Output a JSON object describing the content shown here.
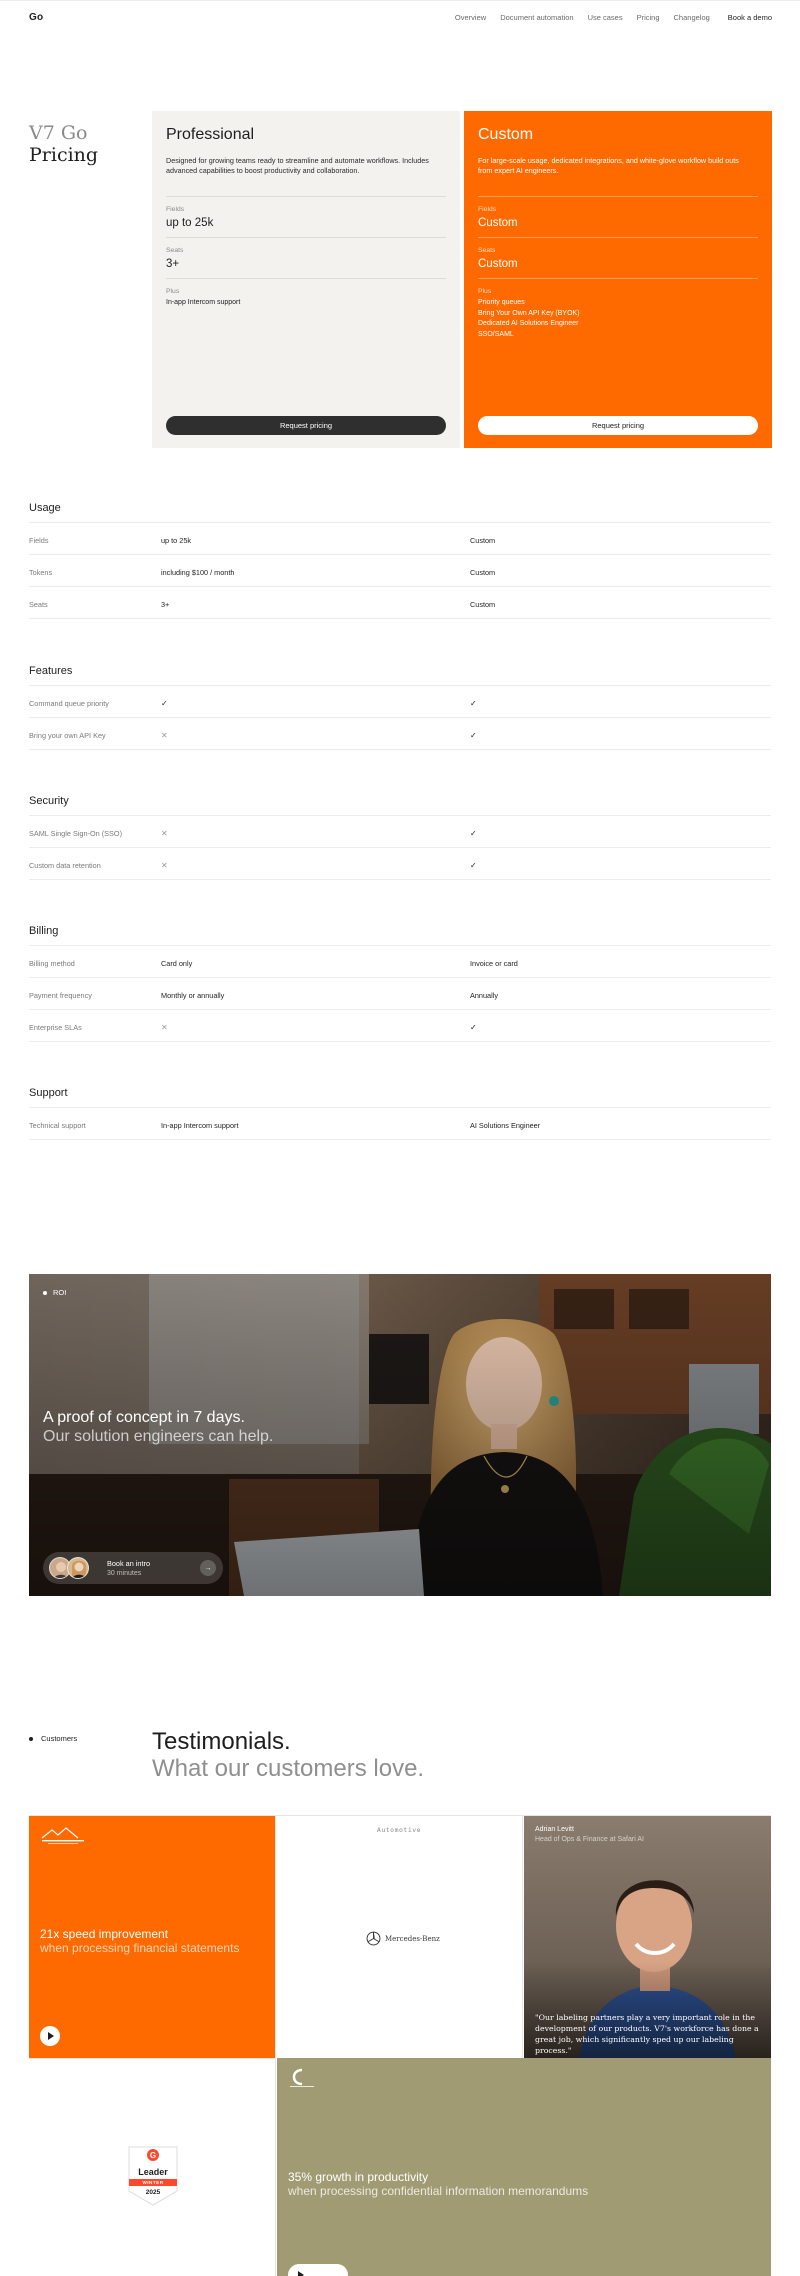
{
  "header": {
    "brand": "Go",
    "nav": [
      "Overview",
      "Document automation",
      "Use cases",
      "Pricing",
      "Changelog"
    ],
    "demo": "Book a demo"
  },
  "product": {
    "line1": "V7 Go",
    "line2": "Pricing"
  },
  "plans": {
    "pro": {
      "name": "Professional",
      "desc": "Designed for growing teams ready to streamline and automate workflows. Includes advanced capabilities to boost productivity and collaboration.",
      "fields_label": "Fields",
      "fields_value": "up to 25k",
      "seats_label": "Seats",
      "seats_value": "3+",
      "plus_label": "Plus",
      "plus": [
        "In-app Intercom support"
      ],
      "button": "Request pricing"
    },
    "custom": {
      "name": "Custom",
      "desc": "For large-scale usage, dedicated integrations, and white-glove workflow build outs from expert AI engineers.",
      "fields_label": "Fields",
      "fields_value": "Custom",
      "seats_label": "Seats",
      "seats_value": "Custom",
      "plus_label": "Plus",
      "plus": [
        "Priority queues",
        "Bring Your Own API Key (BYOK)",
        "Dedicated AI Solutions Engineer",
        "SSO/SAML"
      ],
      "button": "Request pricing"
    }
  },
  "sections": {
    "usage": {
      "title": "Usage",
      "rows": [
        {
          "k": "Fields",
          "p": "up to 25k",
          "c": "Custom"
        },
        {
          "k": "Tokens",
          "p": "including $100 / month",
          "c": "Custom"
        },
        {
          "k": "Seats",
          "p": "3+",
          "c": "Custom"
        }
      ]
    },
    "features": {
      "title": "Features",
      "rows": [
        {
          "k": "Command queue priority",
          "p": "✓",
          "c": "✓"
        },
        {
          "k": "Bring your own API Key",
          "p": "✕",
          "c": "✓"
        }
      ]
    },
    "security": {
      "title": "Security",
      "rows": [
        {
          "k": "SAML Single Sign-On (SSO)",
          "p": "✕",
          "c": "✓"
        },
        {
          "k": "Custom data retention",
          "p": "✕",
          "c": "✓"
        }
      ]
    },
    "billing": {
      "title": "Billing",
      "rows": [
        {
          "k": "Billing method",
          "p": "Card only",
          "c": "Invoice or card"
        },
        {
          "k": "Payment frequency",
          "p": "Monthly or annually",
          "c": "Annually"
        },
        {
          "k": "Enterprise SLAs",
          "p": "✕",
          "c": "✓"
        }
      ]
    },
    "support": {
      "title": "Support",
      "rows": [
        {
          "k": "Technical support",
          "p": "In-app Intercom support",
          "c": "AI Solutions Engineer"
        }
      ]
    }
  },
  "roi": {
    "tag": "ROI",
    "headline": "A proof of concept in 7 days.",
    "sub": "Our solution engineers can help.",
    "pill_title": "Book an intro",
    "pill_sub": "30 minutes",
    "pill_arrow": "→"
  },
  "testimonials": {
    "tag": "Customers",
    "title": "Testimonials.",
    "subtitle": "What our customers love.",
    "card1": {
      "stat": "21x speed improvement",
      "sub": "when processing financial statements"
    },
    "card2": {
      "industry": "Automotive",
      "brand": "Mercedes-Benz"
    },
    "card3": {
      "name": "Adrian Levitt",
      "role": "Head of Ops & Finance at Safari AI",
      "quote": "\"Our labeling partners play a very important role in the development of our products. V7's workforce has done a great job, which significantly sped up our labeling process.\""
    },
    "card4": {
      "badge_title": "Leader",
      "badge_season": "WINTER",
      "badge_year": "2025"
    },
    "card5": {
      "stat": "35% growth in productivity",
      "sub": "when processing confidential information memorandums"
    }
  },
  "colors": {
    "accent": "#ff6a00",
    "dark": "#2f2f2f",
    "olive": "#a19b74"
  }
}
